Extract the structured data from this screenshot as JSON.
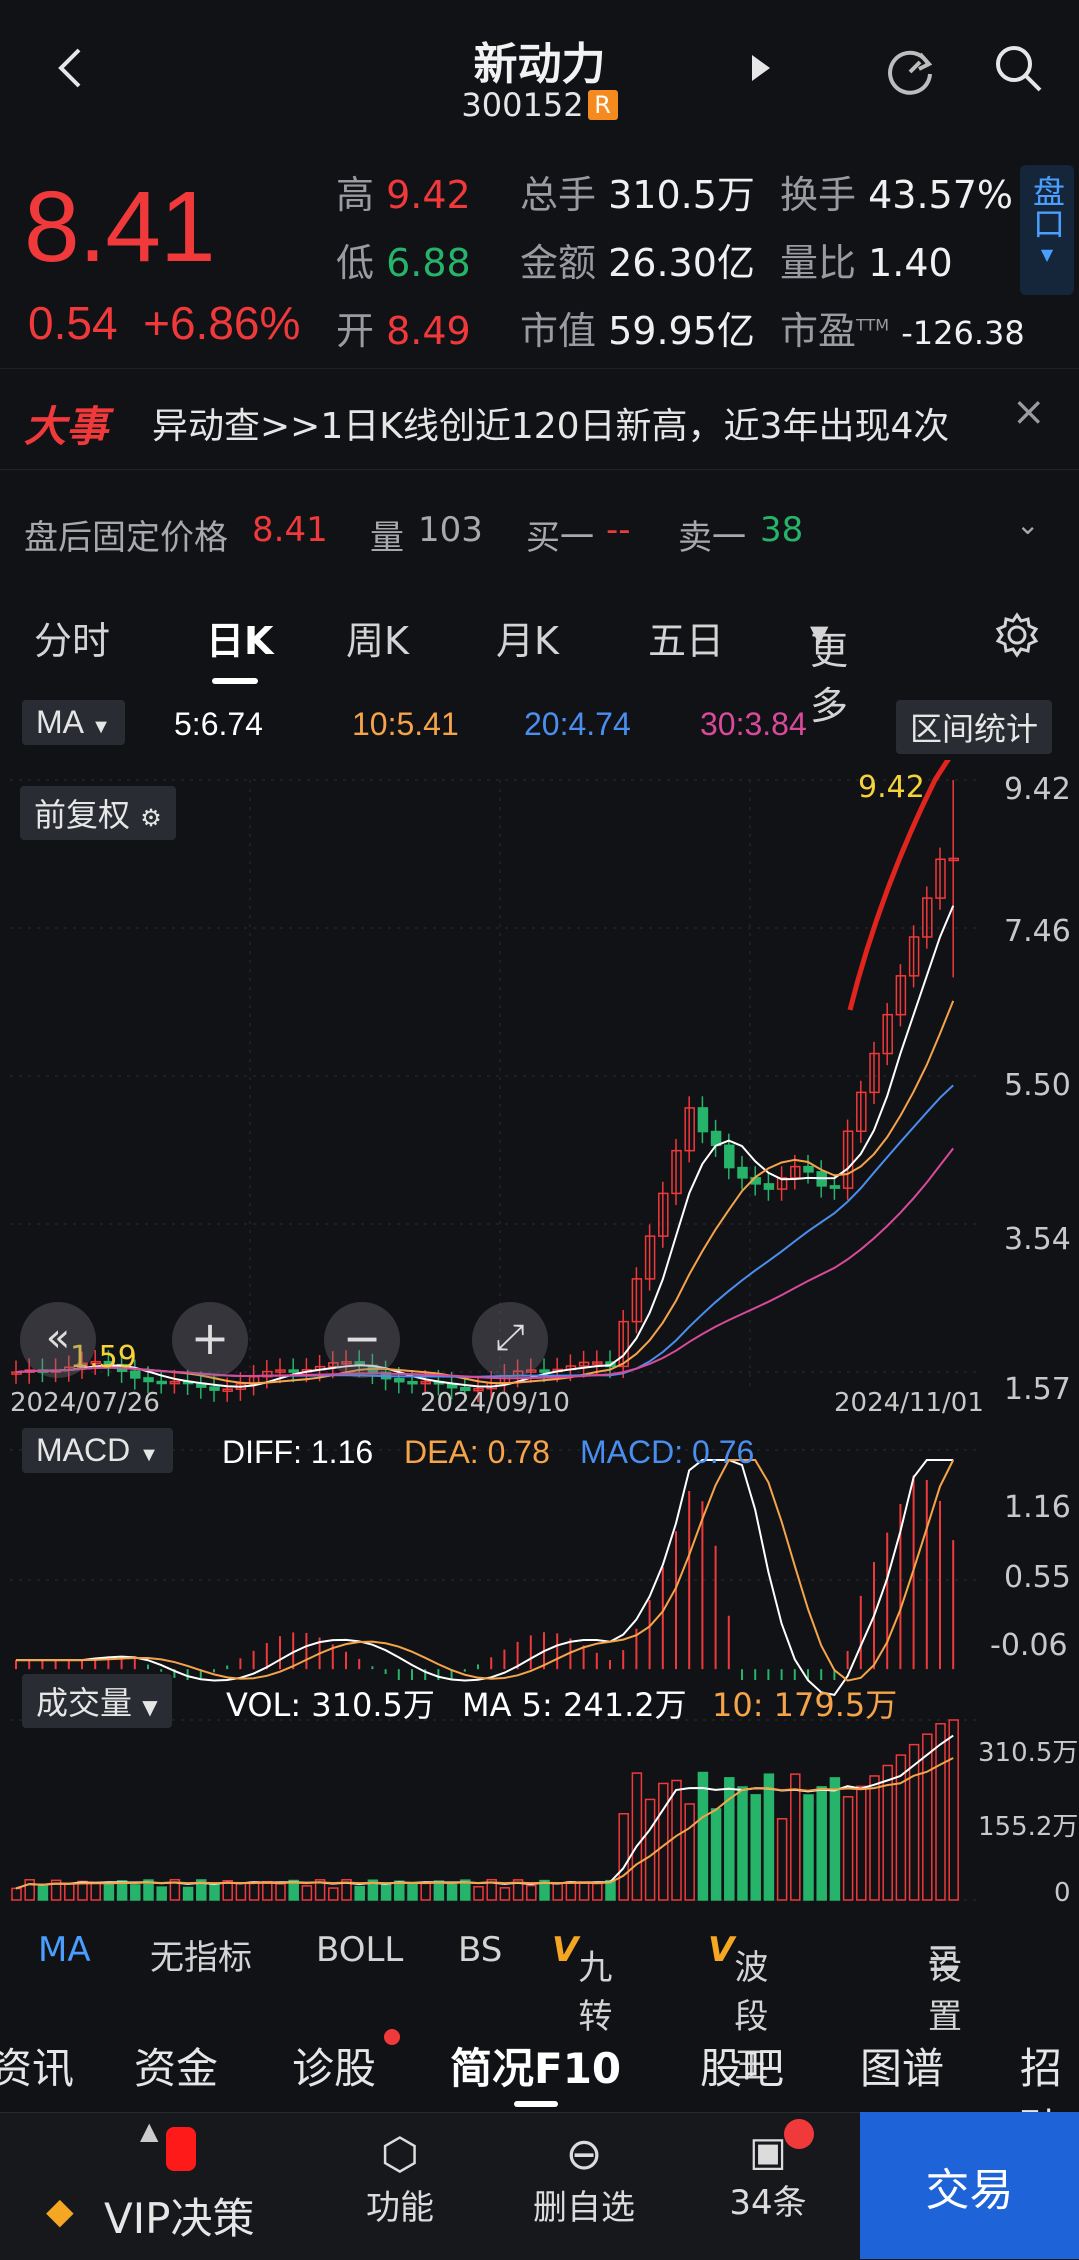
{
  "header": {
    "title": "新动力",
    "code": "300152",
    "badge": "R"
  },
  "quote": {
    "price": "8.41",
    "change": "0.54",
    "change_pct": "+6.86%",
    "high_k": "高",
    "high": "9.42",
    "low_k": "低",
    "low": "6.88",
    "open_k": "开",
    "open": "8.49",
    "vol_k": "总手",
    "vol": "310.5万",
    "amt_k": "金额",
    "amt": "26.30亿",
    "mcap_k": "市值",
    "mcap": "59.95亿",
    "turn_k": "换手",
    "turn": "43.57%",
    "ratio_k": "量比",
    "ratio": "1.40",
    "pe_k": "市盈",
    "pe_sup": "TTM",
    "pe": "-126.38",
    "pankou": "盘口"
  },
  "news": {
    "tag": "大事",
    "text": "异动查>>1日K线创近120日新高，近3年出现4次",
    "close": "×"
  },
  "after_hours": {
    "label": "盘后固定价格",
    "price": "8.41",
    "vol_k": "量",
    "vol": "103",
    "buy_k": "买一",
    "buy": "--",
    "sell_k": "卖一",
    "sell": "38"
  },
  "tabs": [
    "分时",
    "日K",
    "周K",
    "月K",
    "五日",
    "更多"
  ],
  "ma_bar": {
    "selector": "MA",
    "ma5": "5:6.74",
    "ma10": "10:5.41",
    "ma20": "20:4.74",
    "ma30": "30:3.84",
    "range_btn": "区间统计",
    "adjust": "前复权"
  },
  "main_chart": {
    "y_labels": [
      "9.42",
      "7.46",
      "5.50",
      "3.54",
      "1.57"
    ],
    "x_labels": [
      "2024/07/26",
      "2024/09/10",
      "2024/11/01"
    ],
    "high_mark": "9.42",
    "low_mark": "1.59"
  },
  "macd": {
    "selector": "MACD",
    "diff": "DIFF: 1.16",
    "dea": "DEA: 0.78",
    "macd": "MACD: 0.76",
    "y_labels": [
      "1.16",
      "0.55",
      "-0.06"
    ]
  },
  "volume": {
    "selector": "成交量",
    "vol": "VOL: 310.5万",
    "ma5": "MA 5: 241.2万",
    "ma10": "10: 179.5万",
    "y_labels": [
      "310.5万",
      "155.2万",
      "0"
    ]
  },
  "indicators": [
    "MA",
    "无指标",
    "BOLL",
    "BS",
    "九转",
    "波段王",
    "设置"
  ],
  "bottom_tabs": [
    "资讯",
    "资金",
    "诊股",
    "简况F10",
    "股吧",
    "图谱",
    "招聘"
  ],
  "footer": {
    "vip": "VIP决策",
    "func": "功能",
    "del": "删自选",
    "msgs": "34条",
    "trade": "交易"
  },
  "colors": {
    "up": "#f0393b",
    "down": "#26b36a",
    "ma5": "#ffffff",
    "ma10": "#f5a44a",
    "ma20": "#4a8ff0",
    "ma30": "#d84a9a",
    "accent": "#1f63d9"
  }
}
